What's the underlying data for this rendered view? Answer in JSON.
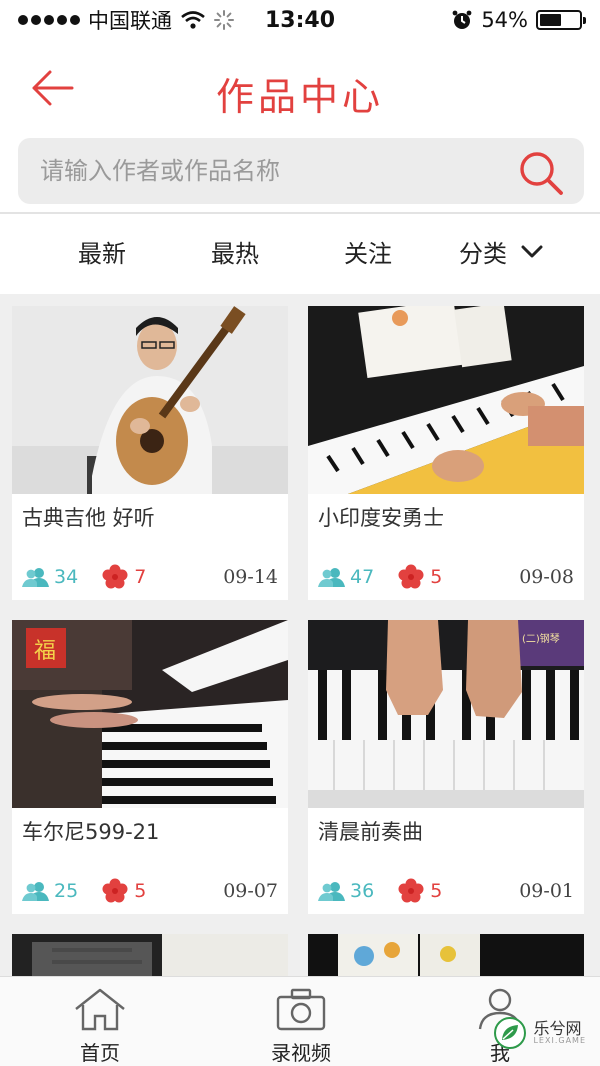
{
  "status_bar": {
    "carrier": "中国联通",
    "time": "13:40",
    "battery_text": "54%",
    "battery_level": 0.54
  },
  "header": {
    "title": "作品中心",
    "back_icon": "arrow-left-icon"
  },
  "search": {
    "placeholder": "请输入作者或作品名称",
    "value": ""
  },
  "tabs": {
    "newest": "最新",
    "hottest": "最热",
    "follow": "关注",
    "category": "分类"
  },
  "works": [
    {
      "title": "古典吉他 好听",
      "users": "34",
      "flowers": "7",
      "date": "09-14"
    },
    {
      "title": "小印度安勇士",
      "users": "47",
      "flowers": "5",
      "date": "09-08"
    },
    {
      "title": "车尔尼599-21",
      "users": "25",
      "flowers": "5",
      "date": "09-07"
    },
    {
      "title": "清晨前奏曲",
      "users": "36",
      "flowers": "5",
      "date": "09-01"
    }
  ],
  "thumb_text": {
    "card3_sign": "福",
    "card4_book": "(二)钢琴"
  },
  "tabbar": {
    "home": "首页",
    "record": "录视频",
    "me": "我"
  },
  "watermark": {
    "text": "乐兮网",
    "sub": "LEXI.GAME"
  },
  "colors": {
    "accent": "#e2413f",
    "teal": "#4ab8be"
  }
}
